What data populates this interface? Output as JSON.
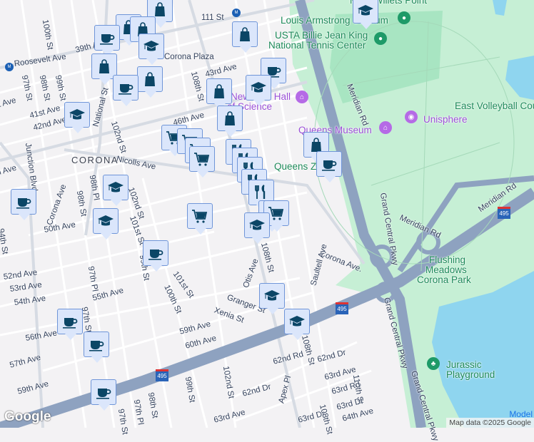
{
  "map": {
    "neighborhood": "CORONA",
    "streets": [
      "100th St",
      "111 St",
      "39th Ave",
      "Roosevelt Ave",
      "Corona Plaza",
      "108th St",
      "43rd Ave",
      "97th St",
      "98th St",
      "99th St",
      "41st Ave",
      "42nd Ave",
      "National St",
      "102nd St",
      "46th Ave",
      "Junction Blvd",
      "Nicolls Ave",
      "Corona Ave",
      "98th St",
      "98th Pl",
      "102nd St",
      "50th Ave",
      "101st St",
      "99th St",
      "101st St",
      "100th St",
      "52nd Ave",
      "53rd Ave",
      "54th Ave",
      "55th Ave",
      "97th Pl",
      "97th St",
      "56th Ave",
      "57th Ave",
      "59th Ave",
      "Granger St",
      "Xenia St",
      "59th Ave",
      "60th Ave",
      "Otis Ave",
      "108th St",
      "102nd St",
      "99th St",
      "98th St",
      "97th Pl",
      "97th St",
      "62nd Dr",
      "63rd Ave",
      "Apex Pl",
      "62nd Rd",
      "62nd Dr",
      "63rd Ave",
      "110th St",
      "63rd Rd",
      "63rd Dr",
      "63rd Dr",
      "64th Ave",
      "108th St",
      "108th St",
      "Corona Ave.",
      "Saultell Ave",
      "Grand Central Pkwy",
      "Grand Central Pkwy",
      "Grand Central Pkwy",
      "Meridian Rd",
      "Meridian Rd",
      "Meridian Rd",
      "41st Ave",
      "50th Ave",
      "94th St"
    ],
    "pois_green": [
      "Louis Armstrong Stadium",
      "USTA Billie Jean King",
      "National Tennis Center",
      "Queens Zoo",
      "Flushing",
      "Meadows",
      "Corona Park",
      "Jurassic",
      "Playground",
      "East Volleyball Court",
      "Mets-Willets Point"
    ],
    "pois_purple": [
      "New York Hall",
      "of Science",
      "Queens Museum",
      "Unisphere"
    ],
    "highway_shield": "495",
    "markers": [
      "shopping-bag",
      "shopping-bag",
      "shopping-bag",
      "shopping-bag",
      "coffee",
      "graduation-cap",
      "shopping-bag",
      "shopping-bag",
      "coffee",
      "graduation-cap",
      "graduation-cap",
      "coffee",
      "graduation-cap",
      "shopping-bag",
      "shopping-bag",
      "shopping-bag",
      "coffee",
      "shopping-cart",
      "shopping-cart",
      "shopping-cart",
      "shopping-cart",
      "restaurant",
      "restaurant",
      "restaurant",
      "restaurant",
      "restaurant",
      "shopping-cart",
      "shopping-cart",
      "graduation-cap",
      "shopping-cart",
      "graduation-cap",
      "graduation-cap",
      "coffee",
      "coffee",
      "graduation-cap",
      "graduation-cap",
      "coffee",
      "coffee",
      "coffee"
    ],
    "colors": {
      "marker_bg": "#dbe6fb",
      "marker_border": "#6f95d8",
      "icon": "#0b4666",
      "park": "#c6efd5",
      "water": "#8fd5ef",
      "highway": "#8ea2c0"
    }
  },
  "footer": {
    "logo": "Google",
    "attribution": "Map data ©2025 Google",
    "model": "Model"
  }
}
